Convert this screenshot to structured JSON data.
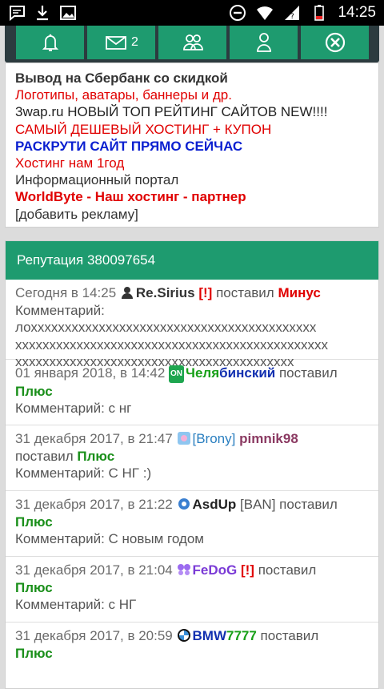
{
  "status_bar": {
    "time": "14:25"
  },
  "topbar": {
    "mail_count": "2"
  },
  "ads": [
    {
      "text": "Вывод на Сбербанк со скидкой",
      "color": "#333333",
      "bold": true
    },
    {
      "text": "Логотипы, аватары, баннеры и др.",
      "color": "#e00000",
      "bold": false
    },
    {
      "text": "3wap.ru НОВЫЙ ТОП РЕЙТИНГ САЙТОВ NEW!!!!",
      "color": "#222222",
      "bold": false
    },
    {
      "text": "САМЫЙ ДЕШЕВЫЙ ХОСТИНГ + КУПОН",
      "color": "#e00000",
      "bold": false
    },
    {
      "text": "РАСКРУТИ САЙТ ПРЯМО СЕЙЧАС",
      "color": "#0a1fd0",
      "bold": true
    },
    {
      "text": "Хостинг нам 1год",
      "color": "#e00000",
      "bold": false
    },
    {
      "text": "Информационный портал",
      "color": "#333333",
      "bold": false
    },
    {
      "text": "WorldByte - Наш хостинг - партнер",
      "color": "#e00000",
      "bold": true
    },
    {
      "text": "[добавить рекламу]",
      "color": "#333333",
      "bold": false
    }
  ],
  "reputation": {
    "title": "Репутация 380097654",
    "entries": [
      {
        "date": "Сегодня в 14:25",
        "user": "Re.Sirius",
        "flag": "[!]",
        "action": "поставил",
        "vote": "Минус",
        "comment_label": "Комментарий:",
        "comment": "лохххххххххххххххххххххххххххххххххххххххххх",
        "comment2": "хххххххххххххххххххххххххххххххххххххххххххххх",
        "comment3": "ххххххххххххххххххххххххххххххххххххххххх"
      },
      {
        "date": "01 января 2018, в 14:42",
        "badge": "ON",
        "user_a": "Челя",
        "user_b": "бинский",
        "action": "поставил",
        "vote": "Плюс",
        "comment": "Комментарий: с нг"
      },
      {
        "date": "31 декабря 2017, в 21:47",
        "tag": "[Brony]",
        "user": "pimnik98",
        "action": "поставил",
        "vote": "Плюс",
        "comment": "Комментарий: С НГ :)"
      },
      {
        "date": "31 декабря 2017, в 21:22",
        "user": "AsdUp",
        "tag": "[BAN]",
        "action": "поставил",
        "vote": "Плюс",
        "comment": "Комментарий: С новым годом"
      },
      {
        "date": "31 декабря 2017, в 21:04",
        "user": "FeDoG",
        "flag": "[!]",
        "action": "поставил",
        "vote": "Плюс",
        "comment": "Комментарий: с НГ"
      },
      {
        "date": "31 декабря 2017, в 20:59",
        "user_a": "BMW",
        "user_b": "7777",
        "action": "поставил",
        "vote": "Плюс"
      }
    ]
  }
}
